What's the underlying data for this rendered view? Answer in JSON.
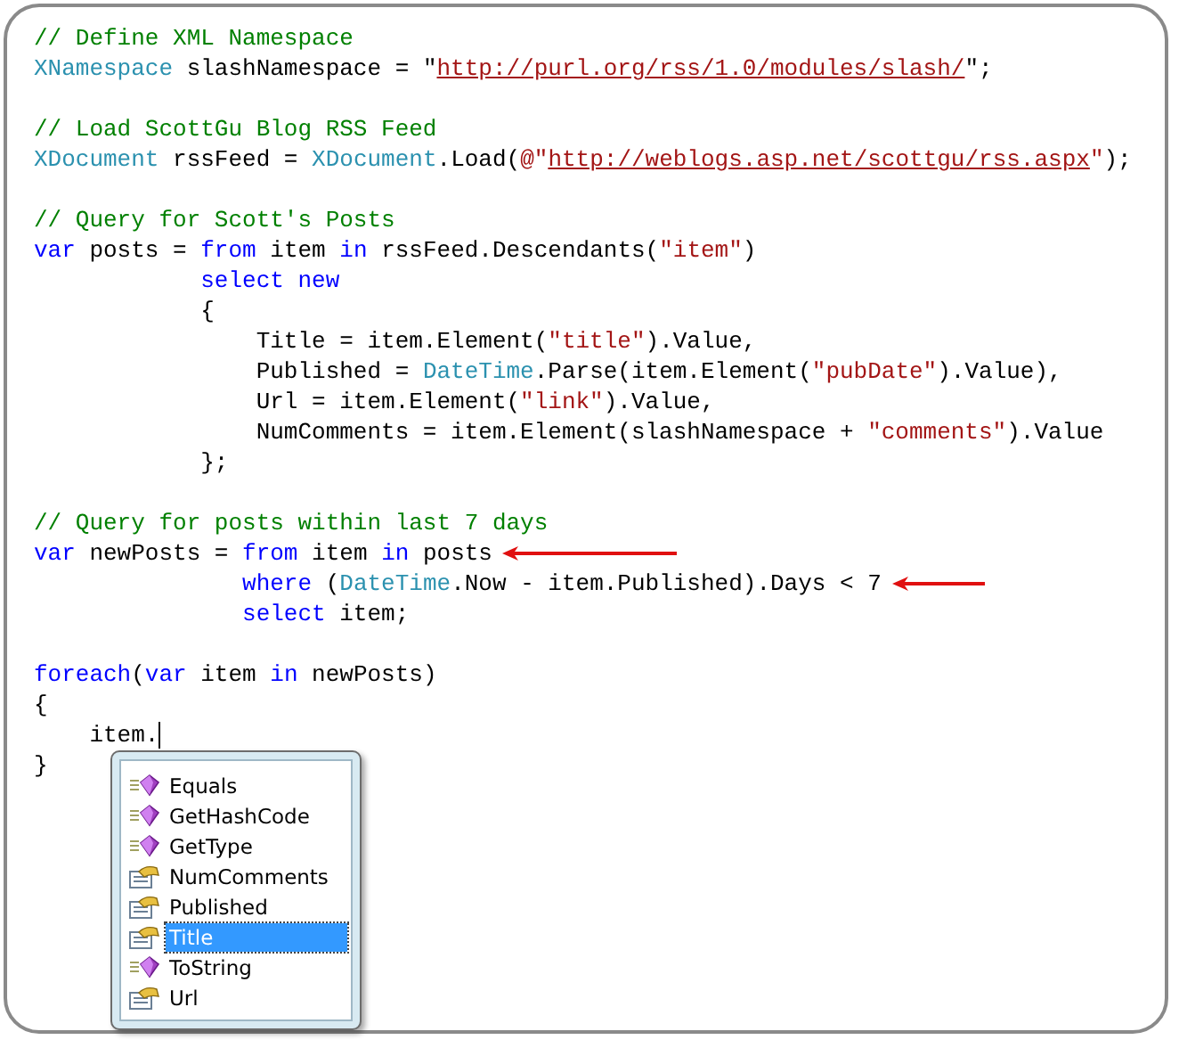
{
  "code_lines": [
    {
      "kind": "code",
      "tokens": [
        {
          "kind": "comment",
          "text": "// Define XML Namespace"
        }
      ]
    },
    {
      "kind": "code",
      "tokens": [
        {
          "kind": "type",
          "text": "XNamespace"
        },
        {
          "kind": "plain",
          "text": " slashNamespace = \""
        },
        {
          "kind": "url",
          "text": "http://purl.org/rss/1.0/modules/slash/"
        },
        {
          "kind": "plain",
          "text": "\";"
        }
      ]
    },
    {
      "kind": "blank"
    },
    {
      "kind": "code",
      "tokens": [
        {
          "kind": "comment",
          "text": "// Load ScottGu Blog RSS Feed"
        }
      ]
    },
    {
      "kind": "code",
      "tokens": [
        {
          "kind": "type",
          "text": "XDocument"
        },
        {
          "kind": "plain",
          "text": " rssFeed = "
        },
        {
          "kind": "type",
          "text": "XDocument"
        },
        {
          "kind": "plain",
          "text": ".Load("
        },
        {
          "kind": "string",
          "text": "@\""
        },
        {
          "kind": "url",
          "text": "http://weblogs.asp.net/scottgu/rss.aspx"
        },
        {
          "kind": "string",
          "text": "\""
        },
        {
          "kind": "plain",
          "text": ");"
        }
      ]
    },
    {
      "kind": "blank"
    },
    {
      "kind": "code",
      "tokens": [
        {
          "kind": "comment",
          "text": "// Query for Scott's Posts"
        }
      ]
    },
    {
      "kind": "code",
      "tokens": [
        {
          "kind": "keyword",
          "text": "var"
        },
        {
          "kind": "plain",
          "text": " posts = "
        },
        {
          "kind": "keyword",
          "text": "from"
        },
        {
          "kind": "plain",
          "text": " item "
        },
        {
          "kind": "keyword",
          "text": "in"
        },
        {
          "kind": "plain",
          "text": " rssFeed.Descendants("
        },
        {
          "kind": "string",
          "text": "\"item\""
        },
        {
          "kind": "plain",
          "text": ")"
        }
      ]
    },
    {
      "kind": "code",
      "tokens": [
        {
          "kind": "keyword",
          "text": "            select new"
        }
      ]
    },
    {
      "kind": "code",
      "tokens": [
        {
          "kind": "plain",
          "text": "            {"
        }
      ]
    },
    {
      "kind": "code",
      "tokens": [
        {
          "kind": "plain",
          "text": "                Title = item.Element("
        },
        {
          "kind": "string",
          "text": "\"title\""
        },
        {
          "kind": "plain",
          "text": ").Value,"
        }
      ]
    },
    {
      "kind": "code",
      "tokens": [
        {
          "kind": "plain",
          "text": "                Published = "
        },
        {
          "kind": "type",
          "text": "DateTime"
        },
        {
          "kind": "plain",
          "text": ".Parse(item.Element("
        },
        {
          "kind": "string",
          "text": "\"pubDate\""
        },
        {
          "kind": "plain",
          "text": ").Value),"
        }
      ]
    },
    {
      "kind": "code",
      "tokens": [
        {
          "kind": "plain",
          "text": "                Url = item.Element("
        },
        {
          "kind": "string",
          "text": "\"link\""
        },
        {
          "kind": "plain",
          "text": ").Value,"
        }
      ]
    },
    {
      "kind": "code",
      "tokens": [
        {
          "kind": "plain",
          "text": "                NumComments = item.Element(slashNamespace + "
        },
        {
          "kind": "string",
          "text": "\"comments\""
        },
        {
          "kind": "plain",
          "text": ").Value"
        }
      ]
    },
    {
      "kind": "code",
      "tokens": [
        {
          "kind": "plain",
          "text": "            };"
        }
      ]
    },
    {
      "kind": "blank"
    },
    {
      "kind": "code",
      "tokens": [
        {
          "kind": "comment",
          "text": "// Query for posts within last 7 days"
        }
      ]
    },
    {
      "kind": "code",
      "arrow": true,
      "tokens": [
        {
          "kind": "keyword",
          "text": "var"
        },
        {
          "kind": "plain",
          "text": " newPosts = "
        },
        {
          "kind": "keyword",
          "text": "from"
        },
        {
          "kind": "plain",
          "text": " item "
        },
        {
          "kind": "keyword",
          "text": "in"
        },
        {
          "kind": "plain",
          "text": " posts"
        }
      ]
    },
    {
      "kind": "code",
      "arrow": true,
      "tokens": [
        {
          "kind": "keyword",
          "text": "               where"
        },
        {
          "kind": "plain",
          "text": " ("
        },
        {
          "kind": "type",
          "text": "DateTime"
        },
        {
          "kind": "plain",
          "text": ".Now - item.Published).Days < 7"
        }
      ]
    },
    {
      "kind": "code",
      "tokens": [
        {
          "kind": "keyword",
          "text": "               select"
        },
        {
          "kind": "plain",
          "text": " item;"
        }
      ]
    },
    {
      "kind": "blank"
    },
    {
      "kind": "code",
      "tokens": [
        {
          "kind": "keyword",
          "text": "foreach"
        },
        {
          "kind": "plain",
          "text": "("
        },
        {
          "kind": "keyword",
          "text": "var"
        },
        {
          "kind": "plain",
          "text": " item "
        },
        {
          "kind": "keyword",
          "text": "in"
        },
        {
          "kind": "plain",
          "text": " newPosts)"
        }
      ]
    },
    {
      "kind": "code",
      "tokens": [
        {
          "kind": "plain",
          "text": "{"
        }
      ]
    },
    {
      "kind": "code",
      "cursor": true,
      "tokens": [
        {
          "kind": "plain",
          "text": "    item."
        }
      ]
    },
    {
      "kind": "code",
      "tokens": [
        {
          "kind": "plain",
          "text": "}"
        }
      ]
    }
  ],
  "completion_list": [
    {
      "kind": "method",
      "label": "Equals",
      "selected": false
    },
    {
      "kind": "method",
      "label": "GetHashCode",
      "selected": false
    },
    {
      "kind": "method",
      "label": "GetType",
      "selected": false
    },
    {
      "kind": "property",
      "label": "NumComments",
      "selected": false
    },
    {
      "kind": "property",
      "label": "Published",
      "selected": false
    },
    {
      "kind": "property",
      "label": "Title",
      "selected": true
    },
    {
      "kind": "method",
      "label": "ToString",
      "selected": false
    },
    {
      "kind": "property",
      "label": "Url",
      "selected": false
    }
  ]
}
